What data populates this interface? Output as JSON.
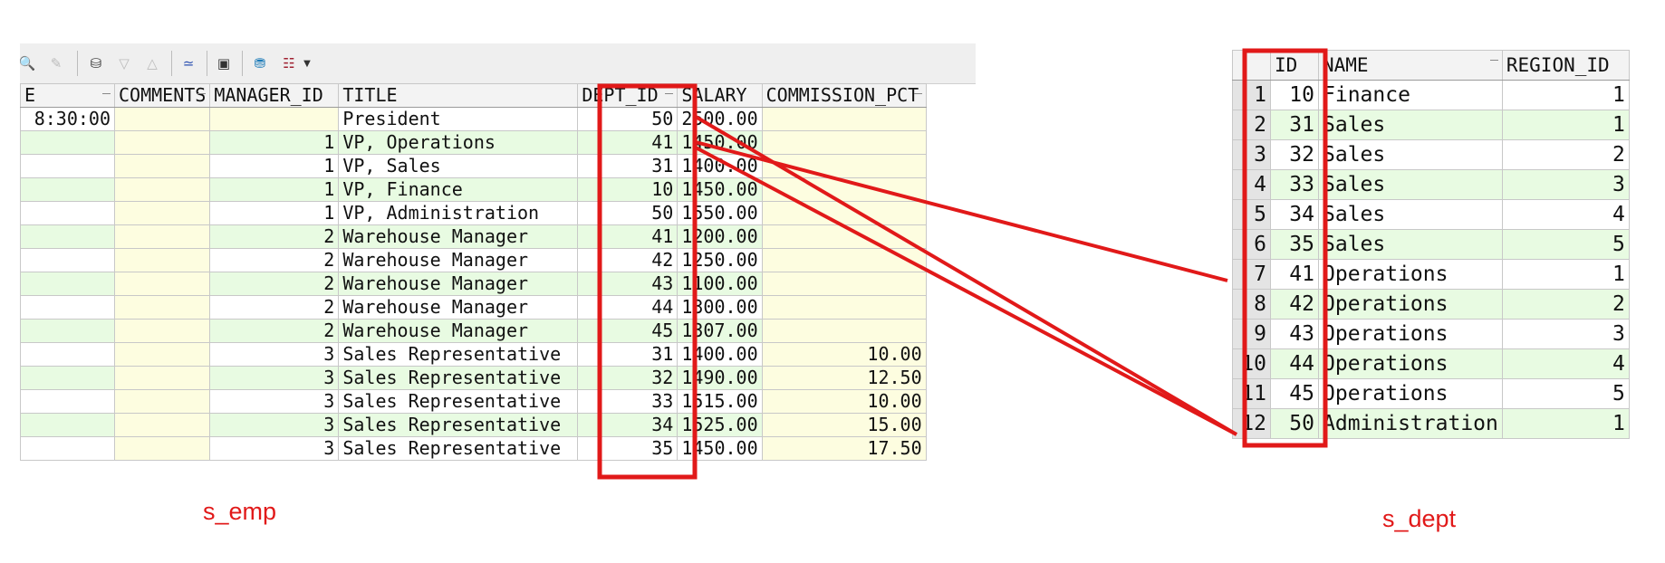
{
  "toolbar": {
    "icons": [
      "binoculars-icon",
      "eraser-icon",
      "db-record-icon",
      "arrow-down-icon",
      "arrow-up-icon",
      "chart-icon",
      "save-icon",
      "db-export-icon",
      "report-icon",
      "dropdown-arrow-icon"
    ]
  },
  "emp": {
    "caption": "s_emp",
    "columns": [
      "E",
      "COMMENTS",
      "MANAGER_ID",
      "TITLE",
      "DEPT_ID",
      "SALARY",
      "COMMISSION_PCT"
    ],
    "rows": [
      {
        "start": "8:30:00",
        "comments": "",
        "manager_id": "",
        "title": "President",
        "dept_id": "50",
        "salary": "2500.00",
        "commission": ""
      },
      {
        "start": "",
        "comments": "",
        "manager_id": "1",
        "title": "VP, Operations",
        "dept_id": "41",
        "salary": "1450.00",
        "commission": ""
      },
      {
        "start": "",
        "comments": "",
        "manager_id": "1",
        "title": "VP, Sales",
        "dept_id": "31",
        "salary": "1400.00",
        "commission": ""
      },
      {
        "start": "",
        "comments": "",
        "manager_id": "1",
        "title": "VP, Finance",
        "dept_id": "10",
        "salary": "1450.00",
        "commission": ""
      },
      {
        "start": "",
        "comments": "",
        "manager_id": "1",
        "title": "VP, Administration",
        "dept_id": "50",
        "salary": "1550.00",
        "commission": ""
      },
      {
        "start": "",
        "comments": "",
        "manager_id": "2",
        "title": "Warehouse Manager",
        "dept_id": "41",
        "salary": "1200.00",
        "commission": ""
      },
      {
        "start": "",
        "comments": "",
        "manager_id": "2",
        "title": "Warehouse Manager",
        "dept_id": "42",
        "salary": "1250.00",
        "commission": ""
      },
      {
        "start": "",
        "comments": "",
        "manager_id": "2",
        "title": "Warehouse Manager",
        "dept_id": "43",
        "salary": "1100.00",
        "commission": ""
      },
      {
        "start": "",
        "comments": "",
        "manager_id": "2",
        "title": "Warehouse Manager",
        "dept_id": "44",
        "salary": "1300.00",
        "commission": ""
      },
      {
        "start": "",
        "comments": "",
        "manager_id": "2",
        "title": "Warehouse Manager",
        "dept_id": "45",
        "salary": "1307.00",
        "commission": ""
      },
      {
        "start": "",
        "comments": "",
        "manager_id": "3",
        "title": "Sales Representative",
        "dept_id": "31",
        "salary": "1400.00",
        "commission": "10.00"
      },
      {
        "start": "",
        "comments": "",
        "manager_id": "3",
        "title": "Sales Representative",
        "dept_id": "32",
        "salary": "1490.00",
        "commission": "12.50"
      },
      {
        "start": "",
        "comments": "",
        "manager_id": "3",
        "title": "Sales Representative",
        "dept_id": "33",
        "salary": "1515.00",
        "commission": "10.00"
      },
      {
        "start": "",
        "comments": "",
        "manager_id": "3",
        "title": "Sales Representative",
        "dept_id": "34",
        "salary": "1525.00",
        "commission": "15.00"
      },
      {
        "start": "",
        "comments": "",
        "manager_id": "3",
        "title": "Sales Representative",
        "dept_id": "35",
        "salary": "1450.00",
        "commission": "17.50"
      }
    ]
  },
  "dept": {
    "caption": "s_dept",
    "columns": [
      "",
      "ID",
      "NAME",
      "REGION_ID"
    ],
    "rows": [
      {
        "n": "1",
        "id": "10",
        "name": "Finance",
        "region": "1"
      },
      {
        "n": "2",
        "id": "31",
        "name": "Sales",
        "region": "1"
      },
      {
        "n": "3",
        "id": "32",
        "name": "Sales",
        "region": "2"
      },
      {
        "n": "4",
        "id": "33",
        "name": "Sales",
        "region": "3"
      },
      {
        "n": "5",
        "id": "34",
        "name": "Sales",
        "region": "4"
      },
      {
        "n": "6",
        "id": "35",
        "name": "Sales",
        "region": "5"
      },
      {
        "n": "7",
        "id": "41",
        "name": "Operations",
        "region": "1"
      },
      {
        "n": "8",
        "id": "42",
        "name": "Operations",
        "region": "2"
      },
      {
        "n": "9",
        "id": "43",
        "name": "Operations",
        "region": "3"
      },
      {
        "n": "10",
        "id": "44",
        "name": "Operations",
        "region": "4"
      },
      {
        "n": "11",
        "id": "45",
        "name": "Operations",
        "region": "5"
      },
      {
        "n": "12",
        "id": "50",
        "name": "Administration",
        "region": "1"
      }
    ]
  },
  "colors": {
    "highlight_red": "#e11919",
    "row_green": "#e8fbe2",
    "comment_yellow": "#fdfde0"
  }
}
